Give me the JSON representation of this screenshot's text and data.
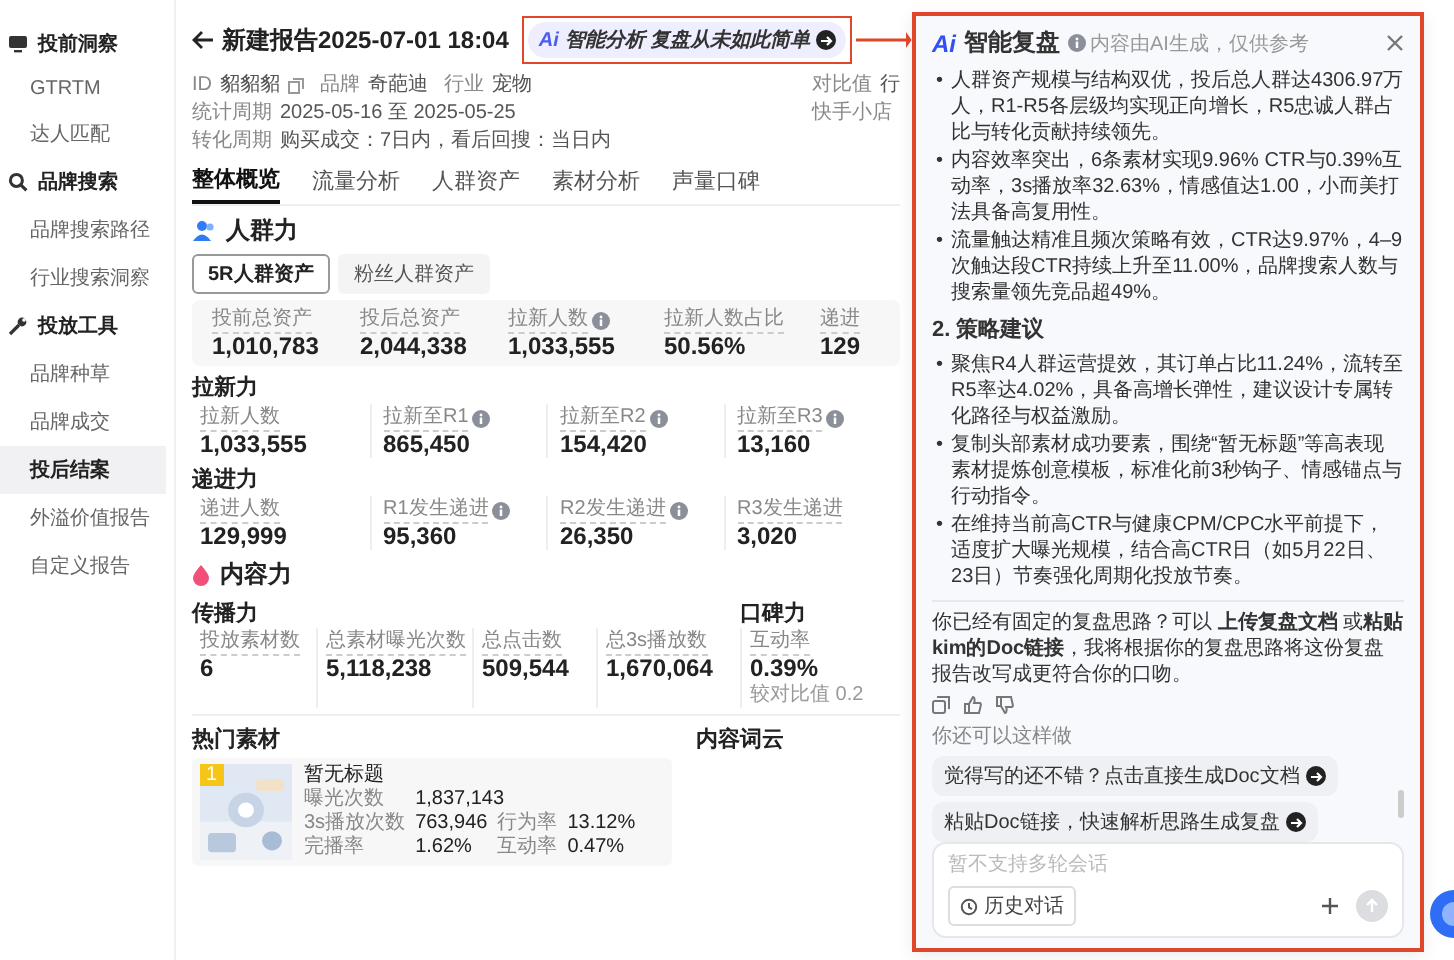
{
  "sidebar": {
    "groups": [
      {
        "label": "投前洞察",
        "items": [
          {
            "label": "GTRTM",
            "selected": false
          },
          {
            "label": "达人匹配",
            "selected": false
          }
        ]
      },
      {
        "label": "品牌搜索",
        "items": [
          {
            "label": "品牌搜索路径",
            "selected": false
          },
          {
            "label": "行业搜索洞察",
            "selected": false
          }
        ]
      },
      {
        "label": "投放工具",
        "items": [
          {
            "label": "品牌种草",
            "selected": false
          },
          {
            "label": "品牌成交",
            "selected": false
          },
          {
            "label": "投后结案",
            "selected": true
          },
          {
            "label": "外溢价值报告",
            "selected": false
          },
          {
            "label": "自定义报告",
            "selected": false
          }
        ]
      }
    ]
  },
  "header": {
    "title": "新建报告2025-07-01 18:04",
    "ai_badge": {
      "logo": "Ai",
      "label": "智能分析 复盘从未如此简单"
    }
  },
  "meta": [
    {
      "label": "ID",
      "value": "貂貂貂"
    },
    {
      "label": "品牌",
      "value": "奇葩迪"
    },
    {
      "label": "行业",
      "value": "宠物"
    },
    {
      "label": "统计周期",
      "value": "2025-05-16 至 2025-05-25"
    }
  ],
  "compare": {
    "label": "对比值",
    "value": "行"
  },
  "conversion": {
    "label": "转化周期",
    "value": "购买成交：7日内，看后回搜：当日内"
  },
  "shop": "快手小店",
  "tabs": [
    {
      "label": "整体概览",
      "selected": true
    },
    {
      "label": "流量分析",
      "selected": false
    },
    {
      "label": "人群资产",
      "selected": false
    },
    {
      "label": "素材分析",
      "selected": false
    },
    {
      "label": "声量口碑",
      "selected": false
    }
  ],
  "crowd": {
    "title": "人群力",
    "toggles": [
      {
        "label": "5R人群资产",
        "selected": true
      },
      {
        "label": "粉丝人群资产",
        "selected": false
      }
    ],
    "summary": [
      {
        "label": "投前总资产",
        "value": "1,010,783",
        "info": false
      },
      {
        "label": "投后总资产",
        "value": "2,044,338",
        "info": false
      },
      {
        "label": "拉新人数",
        "value": "1,033,555",
        "info": true
      },
      {
        "label": "拉新人数占比",
        "value": "50.56%",
        "info": false
      },
      {
        "label": "递进",
        "value": "129",
        "info": false
      }
    ],
    "pull_new": {
      "title": "拉新力",
      "stats": [
        {
          "label": "拉新人数",
          "value": "1,033,555",
          "info": false
        },
        {
          "label": "拉新至R1",
          "value": "865,450",
          "info": true
        },
        {
          "label": "拉新至R2",
          "value": "154,420",
          "info": true
        },
        {
          "label": "拉新至R3",
          "value": "13,160",
          "info": true
        }
      ]
    },
    "advance": {
      "title": "递进力",
      "stats": [
        {
          "label": "递进人数",
          "value": "129,999",
          "info": false
        },
        {
          "label": "R1发生递进",
          "value": "95,360",
          "info": true
        },
        {
          "label": "R2发生递进",
          "value": "26,350",
          "info": true
        },
        {
          "label": "R3发生递进",
          "value": "3,020",
          "info": false
        }
      ]
    }
  },
  "content": {
    "title": "内容力",
    "spread": {
      "title": "传播力",
      "stats": [
        {
          "label": "投放素材数",
          "value": "6"
        },
        {
          "label": "总素材曝光次数",
          "value": "5,118,238"
        },
        {
          "label": "总点击数",
          "value": "509,544"
        },
        {
          "label": "总3s播放数",
          "value": "1,670,064"
        }
      ]
    },
    "word_of_mouth": {
      "title": "口碑力",
      "stats": [
        {
          "label": "互动率",
          "value": "0.39%",
          "note": "较对比值 0.2"
        }
      ]
    }
  },
  "hot_materials": {
    "title": "热门素材",
    "items": [
      {
        "rank": "1",
        "title": "暂无标题",
        "metrics": [
          {
            "label": "曝光次数",
            "value": "1,837,143"
          },
          {
            "label": "3s播放次数",
            "value": "763,946"
          },
          {
            "label": "行为率",
            "value": "13.12%"
          },
          {
            "label": "完播率",
            "value": "1.62%"
          },
          {
            "label": "互动率",
            "value": "0.47%"
          }
        ]
      }
    ]
  },
  "word_cloud": {
    "title": "内容词云"
  },
  "panel": {
    "logo": "Ai",
    "title": "智能复盘",
    "notice": "内容由AI生成，仅供参考",
    "bullet": "•",
    "summary_points": [
      "人群资产规模与结构双优，投后总人群达4306.97万人，R1-R5各层级均实现正向增长，R5忠诚人群占比与转化贡献持续领先。",
      "内容效率突出，6条素材实现9.96% CTR与0.39%互动率，3s播放率32.63%，情感值达1.00，小而美打法具备高复用性。",
      "流量触达精准且频次策略有效，CTR达9.97%，4–9次触达段CTR持续上升至11.00%，品牌搜索人数与搜索量领先竞品超49%。"
    ],
    "strategy": {
      "heading": "2. 策略建议",
      "points": [
        "聚焦R4人群运营提效，其订单占比11.24%，流转至R5率达4.02%，具备高增长弹性，建议设计专属转化路径与权益激励。",
        "复制头部素材成功要素，围绕“暂无标题”等高表现素材提炼创意模板，标准化前3秒钩子、情感锚点与行动指令。",
        "在维持当前高CTR与健康CPM/CPC水平前提下，适度扩大曝光规模，结合高CTR日（如5月22日、23日）节奏强化周期化投放节奏。"
      ]
    },
    "message": "你已经有固定的复盘思路？可以 **上传复盘文档** 或**粘贴kim的Doc链接**，我将根据你的复盘思路将这份复盘报告改写成更符合你的口吻。",
    "suggest_label": "你还可以这样做",
    "suggestions": [
      "觉得写的还不错？点击直接生成Doc文档",
      "粘贴Doc链接，快速解析思路生成复盘"
    ],
    "input": {
      "placeholder": "暂不支持多轮会话",
      "history_button": "历史对话",
      "send_disabled": true
    }
  }
}
